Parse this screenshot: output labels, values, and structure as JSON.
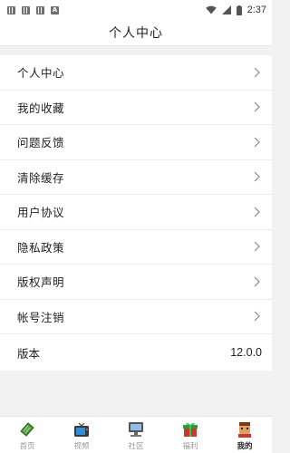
{
  "status_bar": {
    "time": "2:37",
    "icons": [
      "notification-icon",
      "notification-icon",
      "notification-icon",
      "a-icon",
      "wifi-icon",
      "signal-icon",
      "battery-icon"
    ]
  },
  "header": {
    "title": "个人中心"
  },
  "menu": {
    "items": [
      {
        "label": "个人中心"
      },
      {
        "label": "我的收藏"
      },
      {
        "label": "问题反馈"
      },
      {
        "label": "清除缓存"
      },
      {
        "label": "用户协议"
      },
      {
        "label": "隐私政策"
      },
      {
        "label": "版权声明"
      },
      {
        "label": "帐号注销"
      }
    ],
    "version": {
      "label": "版本",
      "value": "12.0.0"
    }
  },
  "bottom_nav": {
    "items": [
      {
        "label": "首页",
        "icon": "home-icon",
        "active": false
      },
      {
        "label": "视频",
        "icon": "tv-icon",
        "active": false
      },
      {
        "label": "社区",
        "icon": "community-icon",
        "active": false
      },
      {
        "label": "福利",
        "icon": "gift-icon",
        "active": false
      },
      {
        "label": "我的",
        "icon": "profile-icon",
        "active": true
      }
    ]
  }
}
